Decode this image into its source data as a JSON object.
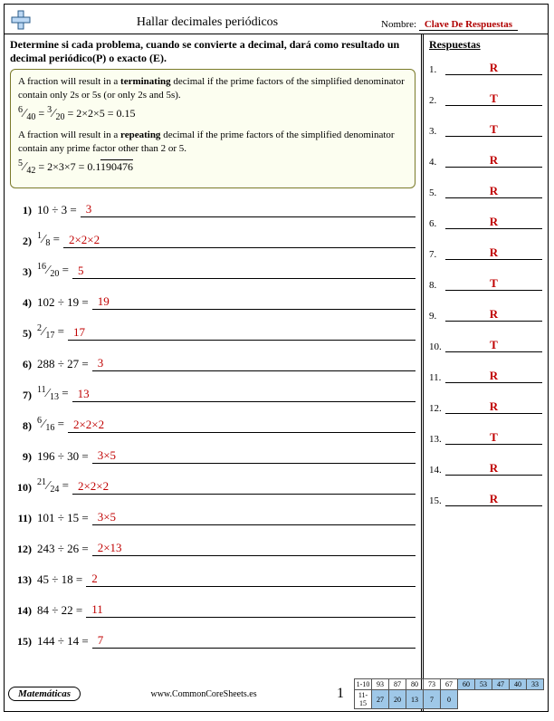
{
  "header": {
    "title": "Hallar decimales periódicos",
    "name_label": "Nombre:",
    "answer_key": "Clave De Respuestas"
  },
  "instructions": "Determine si cada problema, cuando se convierte a decimal, dará como resultado un decimal periódico(P) o exacto (E).",
  "rulebox": {
    "term_text_a": "A fraction will result in a ",
    "term_bold": "terminating",
    "term_text_b": " decimal if the prime factors of the simplified denominator contain only 2s or 5s (or only 2s and 5s).",
    "term_eq_lhs1_n": "6",
    "term_eq_lhs1_d": "40",
    "term_eq_lhs2_n": "3",
    "term_eq_lhs2_d": "20",
    "term_eq_rhs": " = 2×2×5 = 0.15",
    "rep_text_a": "A fraction will result in a ",
    "rep_bold": "repeating",
    "rep_text_b": " decimal if the prime factors of the simplified denominator contain any prime factor other than 2 or 5.",
    "rep_eq_lhs_n": "5",
    "rep_eq_lhs_d": "42",
    "rep_eq_mid": " = 2×3×7 = 0.1",
    "rep_eq_over": "190476"
  },
  "problems": [
    {
      "n": "1)",
      "type": "div",
      "expr": "10 ÷ 3 =",
      "ans": "3"
    },
    {
      "n": "2)",
      "type": "frac",
      "num": "1",
      "den": "8",
      "ans": "2×2×2"
    },
    {
      "n": "3)",
      "type": "frac",
      "num": "16",
      "den": "20",
      "ans": "5"
    },
    {
      "n": "4)",
      "type": "div",
      "expr": "102 ÷ 19 =",
      "ans": "19"
    },
    {
      "n": "5)",
      "type": "frac",
      "num": "2",
      "den": "17",
      "ans": "17"
    },
    {
      "n": "6)",
      "type": "div",
      "expr": "288 ÷ 27 =",
      "ans": "3"
    },
    {
      "n": "7)",
      "type": "frac",
      "num": "11",
      "den": "13",
      "ans": "13"
    },
    {
      "n": "8)",
      "type": "frac",
      "num": "6",
      "den": "16",
      "ans": "2×2×2"
    },
    {
      "n": "9)",
      "type": "div",
      "expr": "196 ÷ 30 =",
      "ans": "3×5"
    },
    {
      "n": "10)",
      "type": "frac",
      "num": "21",
      "den": "24",
      "ans": "2×2×2"
    },
    {
      "n": "11)",
      "type": "div",
      "expr": "101 ÷ 15 =",
      "ans": "3×5"
    },
    {
      "n": "12)",
      "type": "div",
      "expr": "243 ÷ 26 =",
      "ans": "2×13"
    },
    {
      "n": "13)",
      "type": "div",
      "expr": "45 ÷ 18 =",
      "ans": "2"
    },
    {
      "n": "14)",
      "type": "div",
      "expr": "84 ÷ 22 =",
      "ans": "11"
    },
    {
      "n": "15)",
      "type": "div",
      "expr": "144 ÷ 14 =",
      "ans": "7"
    }
  ],
  "answers_header": "Respuestas",
  "answers": [
    {
      "n": "1.",
      "v": "R"
    },
    {
      "n": "2.",
      "v": "T"
    },
    {
      "n": "3.",
      "v": "T"
    },
    {
      "n": "4.",
      "v": "R"
    },
    {
      "n": "5.",
      "v": "R"
    },
    {
      "n": "6.",
      "v": "R"
    },
    {
      "n": "7.",
      "v": "R"
    },
    {
      "n": "8.",
      "v": "T"
    },
    {
      "n": "9.",
      "v": "R"
    },
    {
      "n": "10.",
      "v": "T"
    },
    {
      "n": "11.",
      "v": "R"
    },
    {
      "n": "12.",
      "v": "R"
    },
    {
      "n": "13.",
      "v": "T"
    },
    {
      "n": "14.",
      "v": "R"
    },
    {
      "n": "15.",
      "v": "R"
    }
  ],
  "footer": {
    "subject": "Matemáticas",
    "site": "www.CommonCoreSheets.es",
    "page": "1",
    "grid": {
      "row1_label": "1-10",
      "row1": [
        "93",
        "87",
        "80",
        "73",
        "67",
        "60",
        "53",
        "47",
        "40",
        "33"
      ],
      "row2_label": "11-15",
      "row2": [
        "27",
        "20",
        "13",
        "7",
        "0"
      ]
    }
  }
}
